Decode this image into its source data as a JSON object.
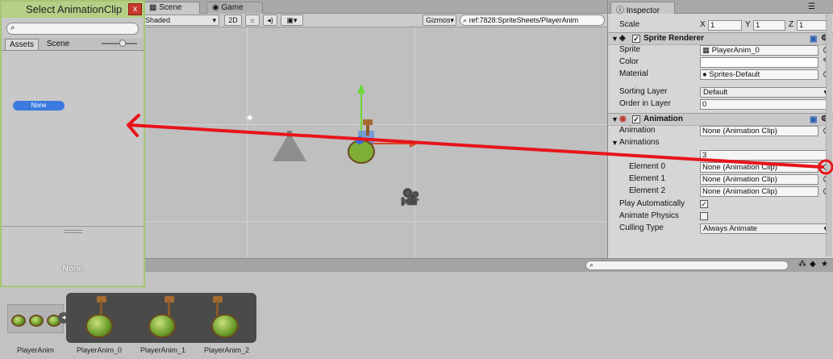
{
  "scene": {
    "tabs": [
      {
        "label": "Scene"
      },
      {
        "label": "Game"
      }
    ],
    "shading": "Shaded",
    "mode_2d": "2D",
    "gizmos": "Gizmos",
    "search": "ref:7828:SpriteSheets/PlayerAnim"
  },
  "inspector": {
    "tab": "Inspector",
    "scale": {
      "label": "Scale",
      "x_label": "X",
      "x": "1",
      "y_label": "Y",
      "y": "1",
      "z_label": "Z",
      "z": "1"
    },
    "sprite_renderer": {
      "title": "Sprite Renderer",
      "sprite_label": "Sprite",
      "sprite": "PlayerAnim_0",
      "color_label": "Color",
      "material_label": "Material",
      "material": "Sprites-Default",
      "sorting_layer_label": "Sorting Layer",
      "sorting_layer": "Default",
      "order_label": "Order in Layer",
      "order": "0"
    },
    "animation": {
      "title": "Animation",
      "animation_label": "Animation",
      "animation": "None (Animation Clip)",
      "animations_label": "Animations",
      "size": "3",
      "elements": [
        {
          "label": "Element 0",
          "value": "None (Animation Clip)"
        },
        {
          "label": "Element 1",
          "value": "None (Animation Clip)"
        },
        {
          "label": "Element 2",
          "value": "None (Animation Clip)"
        }
      ],
      "play_auto_label": "Play Automatically",
      "physics_label": "Animate Physics",
      "culling_label": "Culling Type",
      "culling": "Always Animate"
    }
  },
  "picker": {
    "title": "Select AnimationClip",
    "close": "x",
    "tabs": [
      {
        "label": "Assets"
      },
      {
        "label": "Scene"
      }
    ],
    "none_item": "None",
    "preview_name": "None"
  },
  "assets": [
    {
      "label": "PlayerAnim"
    },
    {
      "label": "PlayerAnim_0"
    },
    {
      "label": "PlayerAnim_1"
    },
    {
      "label": "PlayerAnim_2"
    }
  ],
  "colors": {
    "annotation": "#e8141b",
    "picker_border": "#a7c572",
    "selected": "#3b7be0"
  }
}
